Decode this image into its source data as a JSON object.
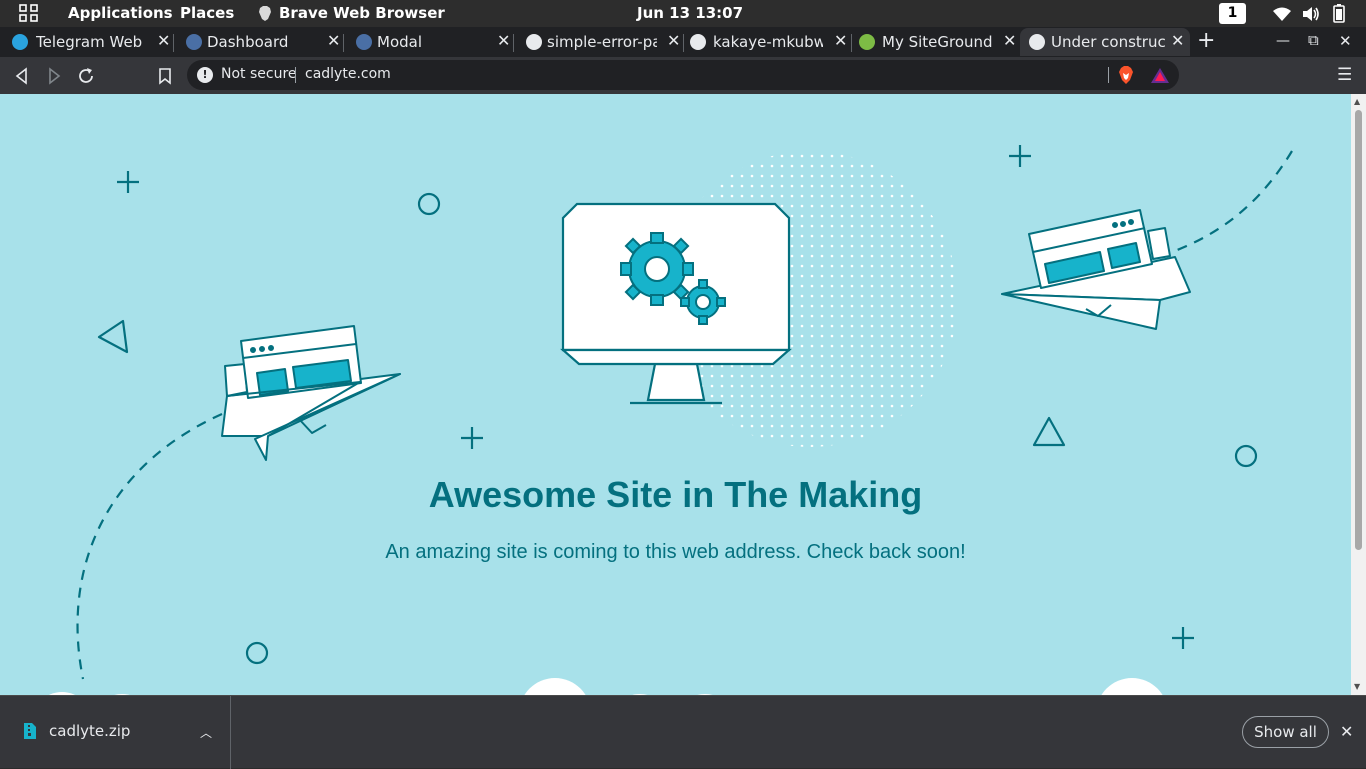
{
  "topbar": {
    "applications": "Applications",
    "places": "Places",
    "app_name": "Brave Web Browser",
    "clock": "Jun 13  13:07",
    "workspace": "1"
  },
  "tabs": [
    {
      "title": "Telegram Web",
      "favicon": "telegram-icon",
      "active": false
    },
    {
      "title": "Dashboard",
      "favicon": "bootstrap-icon",
      "active": false
    },
    {
      "title": "Modal",
      "favicon": "bootstrap-icon",
      "active": false
    },
    {
      "title": "simple-error-pa",
      "favicon": "github-icon",
      "active": false
    },
    {
      "title": "kakaye-mkubwa",
      "favicon": "github-icon",
      "active": false
    },
    {
      "title": "My SiteGround A",
      "favicon": "siteground-icon",
      "active": false
    },
    {
      "title": "Under constructi",
      "favicon": "globe-icon",
      "active": true
    }
  ],
  "omnibox": {
    "security": "Not secure",
    "url": "cadlyte.com"
  },
  "page": {
    "headline": "Awesome Site in The Making",
    "subline": "An amazing site is coming to this web address. Check back soon!",
    "colors": {
      "background": "#a8e1ea",
      "primary": "#04707f",
      "accent": "#17b3cb"
    }
  },
  "downloads": {
    "file_name": "cadlyte.zip",
    "show_all": "Show all"
  }
}
